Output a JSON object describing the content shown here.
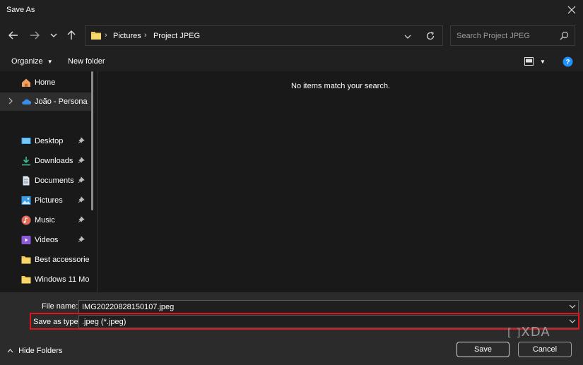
{
  "window": {
    "title": "Save As"
  },
  "address": {
    "crumbs": [
      "Pictures",
      "Project JPEG"
    ]
  },
  "search": {
    "placeholder": "Search Project JPEG"
  },
  "toolbar": {
    "organize_label": "Organize",
    "new_folder_label": "New folder"
  },
  "sidebar": {
    "items": [
      {
        "label": "Home",
        "icon": "home-icon"
      },
      {
        "label": "João - Personal",
        "icon": "onedrive-cloud-icon"
      },
      {
        "label": "Desktop",
        "icon": "desktop-icon"
      },
      {
        "label": "Downloads",
        "icon": "downloads-icon"
      },
      {
        "label": "Documents",
        "icon": "documents-icon"
      },
      {
        "label": "Pictures",
        "icon": "pictures-icon"
      },
      {
        "label": "Music",
        "icon": "music-icon"
      },
      {
        "label": "Videos",
        "icon": "videos-icon"
      },
      {
        "label": "Best accessories",
        "icon": "folder-icon"
      },
      {
        "label": "Windows 11 Mo",
        "icon": "folder-icon"
      }
    ]
  },
  "content": {
    "empty_message": "No items match your search."
  },
  "form": {
    "file_name_label": "File name:",
    "file_name_value": "IMG20220828150107.jpeg",
    "type_label": "Save as type:",
    "type_value": ".jpeg (*.jpeg)"
  },
  "buttons": {
    "save": "Save",
    "cancel": "Cancel",
    "hide_folders": "Hide Folders"
  },
  "watermark": {
    "text": "XDA"
  },
  "colors": {
    "background": "#202020",
    "panel": "#191919",
    "bottom": "#2b2b2b",
    "highlight": "#e0141f",
    "accent": "#1e90ff"
  }
}
